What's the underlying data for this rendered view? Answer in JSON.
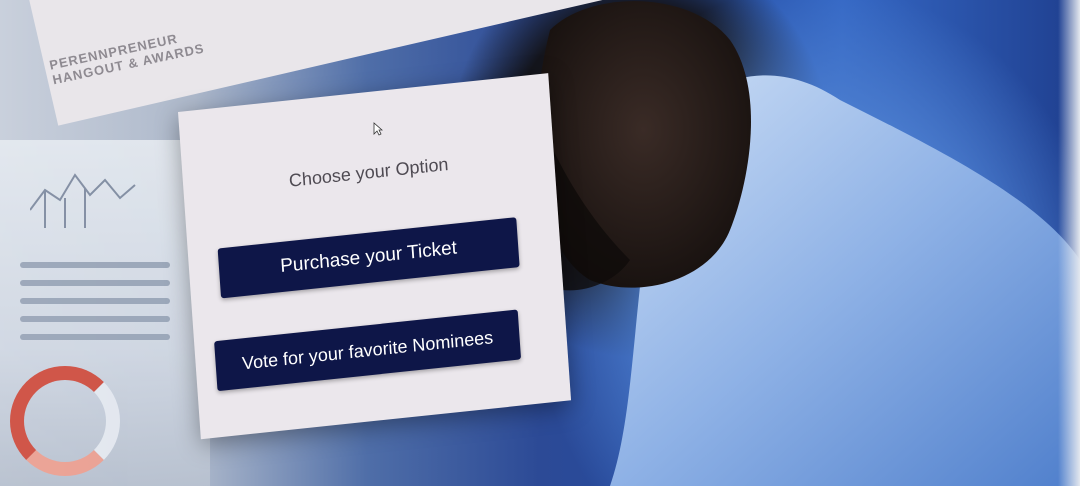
{
  "header": {
    "brand_line1": "PERENNPRENEUR",
    "brand_line2": "HANGOUT & AWARDS"
  },
  "modal": {
    "title": "Choose your Option",
    "buttons": [
      {
        "label": "Purchase your Ticket"
      },
      {
        "label": "Vote for your favorite Nominees"
      }
    ]
  },
  "colors": {
    "button_bg": "#0e1648",
    "modal_bg": "#ebe7ec",
    "title_text": "#4e4a52"
  },
  "icons": {
    "pointer": "mouse-pointer-icon"
  }
}
